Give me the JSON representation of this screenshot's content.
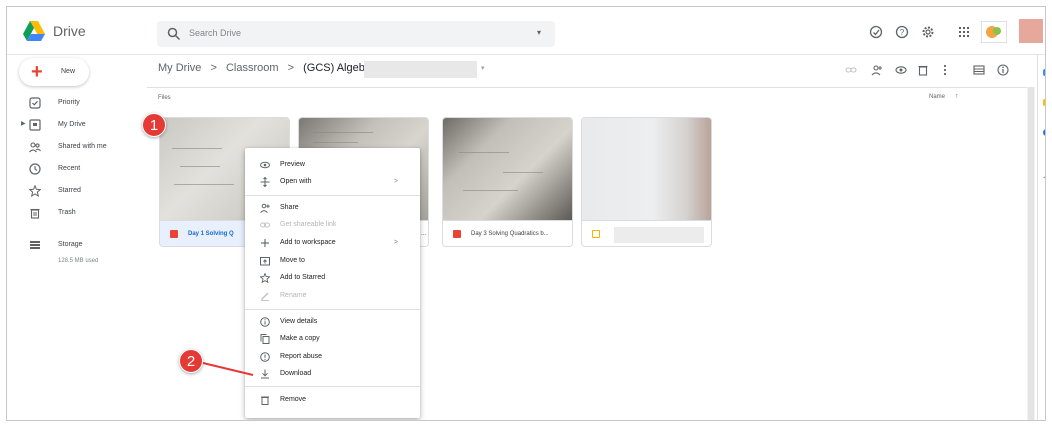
{
  "header": {
    "app_title": "Drive",
    "search_placeholder": "Search Drive"
  },
  "sidebar": {
    "new_label": "New",
    "items": [
      {
        "label": "Priority",
        "icon": "check-circle-icon"
      },
      {
        "label": "My Drive",
        "icon": "my-drive-icon"
      },
      {
        "label": "Shared with me",
        "icon": "people-icon"
      },
      {
        "label": "Recent",
        "icon": "clock-icon"
      },
      {
        "label": "Starred",
        "icon": "star-icon"
      },
      {
        "label": "Trash",
        "icon": "trash-icon"
      }
    ],
    "storage_label": "Storage",
    "storage_used": "128.5 MB used"
  },
  "breadcrumb": {
    "items": [
      "My Drive",
      "Classroom",
      "(GCS) Algebra"
    ],
    "separator": ">"
  },
  "main": {
    "section_label": "Files",
    "sort_label": "Name",
    "sort_arrow": "↑"
  },
  "files": [
    {
      "name": "Day 1 Solving Q",
      "type": "pdf",
      "selected": true
    },
    {
      "name": "...",
      "type": "pdf"
    },
    {
      "name": "Day 3 Solving Quadratics b...",
      "type": "pdf"
    },
    {
      "name": "",
      "type": "slides"
    }
  ],
  "context_menu": {
    "items": [
      {
        "label": "Preview",
        "icon": "eye-icon"
      },
      {
        "label": "Open with",
        "icon": "open-with-icon",
        "submenu": ">"
      },
      {
        "label": "Share",
        "icon": "person-add-icon"
      },
      {
        "label": "Get shareable link",
        "icon": "link-icon",
        "disabled": true
      },
      {
        "label": "Add to workspace",
        "icon": "plus-icon",
        "submenu": ">"
      },
      {
        "label": "Move to",
        "icon": "move-to-icon"
      },
      {
        "label": "Add to Starred",
        "icon": "star-icon"
      },
      {
        "label": "Rename",
        "icon": "pencil-icon",
        "disabled": true
      },
      {
        "label": "View details",
        "icon": "info-icon"
      },
      {
        "label": "Make a copy",
        "icon": "copy-icon"
      },
      {
        "label": "Report abuse",
        "icon": "report-icon"
      },
      {
        "label": "Download",
        "icon": "download-icon"
      },
      {
        "label": "Remove",
        "icon": "trash-icon"
      }
    ]
  },
  "markers": [
    "1",
    "2"
  ],
  "colors": {
    "accent_blue": "#1a73e8",
    "marker_red": "#e53935",
    "pdf_red": "#ea4335",
    "slides_yellow": "#f4b400"
  }
}
